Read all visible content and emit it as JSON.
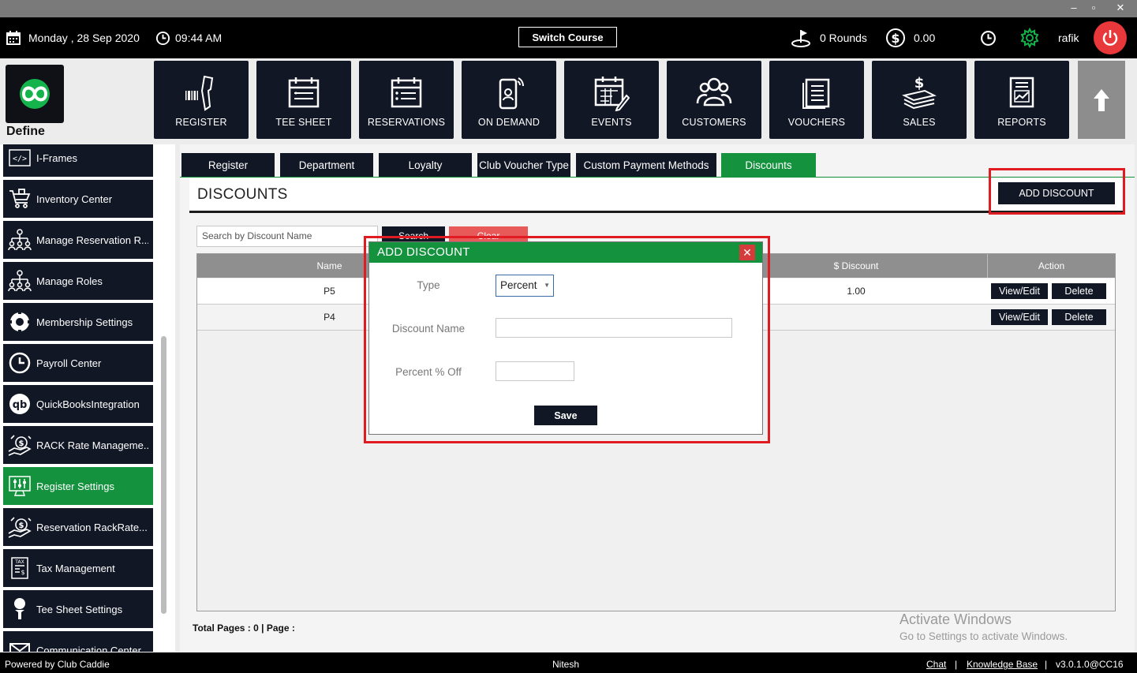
{
  "window_controls": {
    "minimize": "–",
    "restore": "▫",
    "close": "✕"
  },
  "header": {
    "date": "Monday ,  28 Sep 2020",
    "time": "09:44 AM",
    "switch_course": "Switch Course",
    "rounds": "0 Rounds",
    "amount": "0.00",
    "user": "rafik"
  },
  "logo": {
    "label": "Define"
  },
  "modules": [
    {
      "label": "REGISTER",
      "icon": "barcode-scanner-icon"
    },
    {
      "label": "TEE SHEET",
      "icon": "calendar-icon"
    },
    {
      "label": "RESERVATIONS",
      "icon": "calendar-list-icon"
    },
    {
      "label": "ON DEMAND",
      "icon": "mobile-icon"
    },
    {
      "label": "EVENTS",
      "icon": "event-calendar-icon"
    },
    {
      "label": "CUSTOMERS",
      "icon": "users-icon"
    },
    {
      "label": "VOUCHERS",
      "icon": "voucher-icon"
    },
    {
      "label": "SALES",
      "icon": "money-icon"
    },
    {
      "label": "REPORTS",
      "icon": "report-icon"
    }
  ],
  "sidebar": {
    "items": [
      {
        "label": "I-Frames",
        "icon": "code-icon"
      },
      {
        "label": "Inventory Center",
        "icon": "cart-icon"
      },
      {
        "label": "Manage Reservation R...",
        "icon": "org-chart-icon"
      },
      {
        "label": "Manage Roles",
        "icon": "org-chart-icon"
      },
      {
        "label": "Membership Settings",
        "icon": "gear-icon"
      },
      {
        "label": "Payroll Center",
        "icon": "clock-icon"
      },
      {
        "label": "QuickBooksIntegration",
        "icon": "quickbooks-icon"
      },
      {
        "label": "RACK Rate Manageme...",
        "icon": "hand-money-icon"
      },
      {
        "label": "Register Settings",
        "icon": "sliders-icon"
      },
      {
        "label": "Reservation RackRate...",
        "icon": "hand-money-icon"
      },
      {
        "label": "Tax Management",
        "icon": "tax-icon"
      },
      {
        "label": "Tee Sheet Settings",
        "icon": "golf-tee-icon"
      },
      {
        "label": "Communication Center",
        "icon": "message-icon"
      }
    ],
    "active_index": 8
  },
  "tabs": [
    {
      "label": "Register"
    },
    {
      "label": "Department"
    },
    {
      "label": "Loyalty"
    },
    {
      "label": "Club Voucher Type"
    },
    {
      "label": "Custom Payment Methods"
    },
    {
      "label": "Discounts"
    }
  ],
  "active_tab_index": 5,
  "panel": {
    "title": "DISCOUNTS",
    "add_button": "ADD DISCOUNT"
  },
  "search": {
    "placeholder": "Search by Discount Name",
    "search_label": "Search",
    "clear_label": "Clear"
  },
  "grid": {
    "columns": {
      "name": "Name",
      "discount": "$ Discount",
      "action": "Action"
    },
    "rows": [
      {
        "name": "P5",
        "discount": "1.00"
      },
      {
        "name": "P4",
        "discount": ""
      }
    ],
    "view_label": "View/Edit",
    "delete_label": "Delete",
    "total": "Total Pages : 0 | Page :"
  },
  "modal": {
    "title": "ADD DISCOUNT",
    "type_label": "Type",
    "type_value": "Percent",
    "name_label": "Discount Name",
    "name_value": "",
    "percent_label": "Percent % Off",
    "percent_value": "",
    "save_label": "Save"
  },
  "watermark": {
    "line1": "Activate Windows",
    "line2": "Go to Settings to activate Windows."
  },
  "footer": {
    "powered": "Powered by Club Caddie",
    "user": "Nitesh",
    "chat": "Chat",
    "sep": "|",
    "kb": "Knowledge Base",
    "version": "v3.0.1.0@CC16"
  },
  "colors": {
    "accent_green": "#14923e",
    "dark_navy": "#121726",
    "highlight_red": "#e11b22",
    "power_red": "#e8383c"
  }
}
